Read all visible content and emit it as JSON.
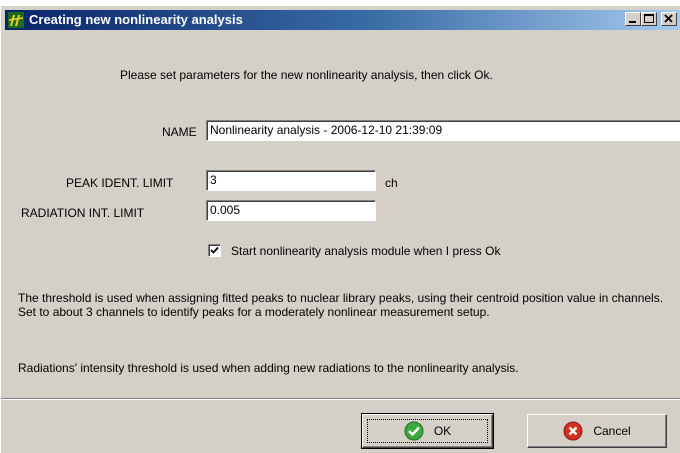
{
  "window": {
    "title": "Creating new nonlinearity analysis",
    "icon": "app-icon"
  },
  "instructions": "Please set parameters for the new nonlinearity analysis, then click Ok.",
  "form": {
    "name_label": "NAME",
    "name_value": "Nonlinearity analysis - 2006-12-10 21:39:09",
    "peak_label": "PEAK IDENT. LIMIT",
    "peak_value": "3",
    "peak_unit": "ch",
    "radiation_label": "RADIATION INT. LIMIT",
    "radiation_value": "0.005",
    "checkbox_label": "Start nonlinearity analysis module when I press Ok",
    "checkbox_checked": true
  },
  "help": {
    "threshold_text": "The threshold is used when assigning fitted peaks to nuclear library peaks, using their centroid position value in channels. Set to about 3 channels to identify peaks for a moderately nonlinear measurement setup.",
    "radiation_text": "Radiations' intensity threshold is used when adding new radiations to the nonlinearity analysis."
  },
  "buttons": {
    "ok_label": "OK",
    "cancel_label": "Cancel"
  },
  "colors": {
    "ok_icon": "#3aa83a",
    "cancel_icon": "#d03020",
    "title_bar": "#0a246a"
  }
}
